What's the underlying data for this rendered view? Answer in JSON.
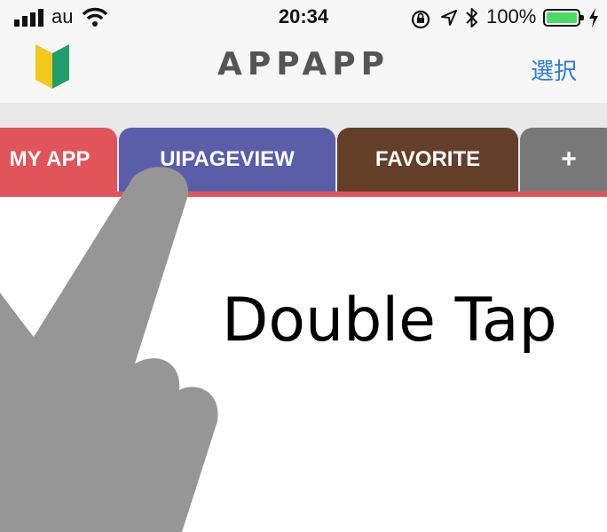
{
  "status_bar": {
    "carrier": "au",
    "time": "20:34",
    "battery_percent": "100%",
    "battery_level": 1.0
  },
  "nav_bar": {
    "title": "APPAPP",
    "right_button": "選択",
    "accent_color": "#2f7bd8"
  },
  "tabs": [
    {
      "label": "MY APP",
      "color": "#e0545a"
    },
    {
      "label": "UIPAGEVIEW",
      "color": "#5a5ea8"
    },
    {
      "label": "FAVORITE",
      "color": "#633e28"
    },
    {
      "label": "+",
      "color": "#787878"
    }
  ],
  "overlay": {
    "caption": "Double Tap"
  }
}
